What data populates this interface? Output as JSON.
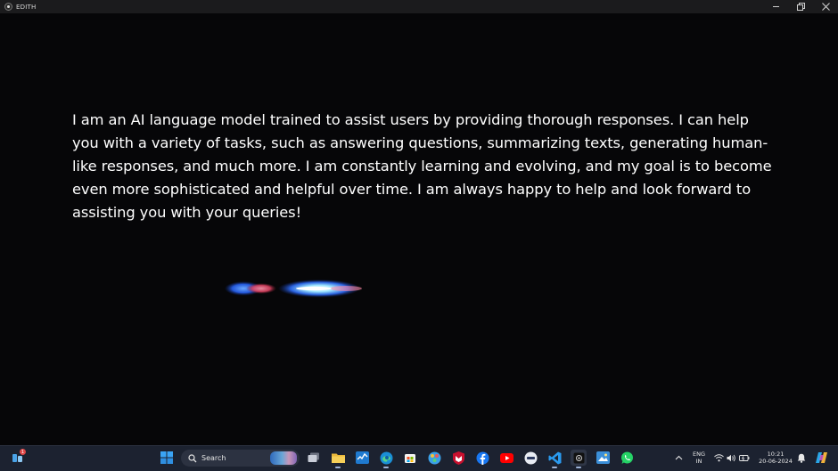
{
  "window": {
    "title": "EDITH",
    "controls": {
      "minimize": "minimize",
      "maximize": "restore",
      "close": "close"
    }
  },
  "assistant": {
    "response": "I am an AI language model trained to assist users by providing thorough responses. I can help you with a variety of tasks, such as answering questions, summarizing texts, generating human-like responses, and much more. I am constantly learning and evolving, and my goal is to become even more sophisticated and helpful over time. I am always happy to help and look forward to assisting you with your queries!",
    "wave_colors": [
      "#2b6fff",
      "#ff5a78",
      "#ffffff",
      "#40ffd0"
    ]
  },
  "taskbar": {
    "widgets_badge": "1",
    "search": {
      "label": "Search"
    },
    "apps": [
      {
        "name": "start",
        "icon": "windows-icon"
      },
      {
        "name": "task-view",
        "icon": "task-view-icon"
      },
      {
        "name": "file-explorer",
        "icon": "folder-icon"
      },
      {
        "name": "task-manager",
        "icon": "chart-icon"
      },
      {
        "name": "edge",
        "icon": "edge-icon"
      },
      {
        "name": "store",
        "icon": "store-icon"
      },
      {
        "name": "color-picker",
        "icon": "palette-icon"
      },
      {
        "name": "mcafee",
        "icon": "shield-icon"
      },
      {
        "name": "facebook",
        "icon": "facebook-icon"
      },
      {
        "name": "youtube",
        "icon": "youtube-icon"
      },
      {
        "name": "media-app",
        "icon": "media-icon"
      },
      {
        "name": "vs-code",
        "icon": "code-icon"
      },
      {
        "name": "edith",
        "icon": "edith-icon"
      },
      {
        "name": "photos",
        "icon": "photo-icon"
      },
      {
        "name": "whatsapp",
        "icon": "whatsapp-icon"
      }
    ],
    "tray": {
      "language_top": "ENG",
      "language_bottom": "IN",
      "time": "10:21",
      "date": "20-06-2024"
    }
  }
}
